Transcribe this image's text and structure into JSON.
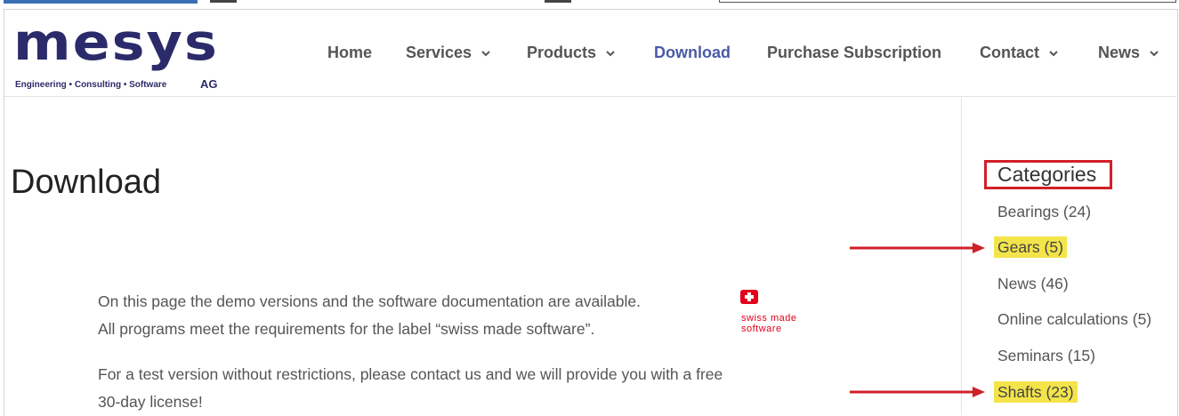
{
  "logo": {
    "word": "mesys",
    "tagline": "Engineering • Consulting • Software",
    "suffix": "AG"
  },
  "nav": {
    "items": [
      {
        "label": "Home",
        "dropdown": false
      },
      {
        "label": "Services",
        "dropdown": true
      },
      {
        "label": "Products",
        "dropdown": true
      },
      {
        "label": "Download",
        "dropdown": false,
        "active": true
      },
      {
        "label": "Purchase Subscription",
        "dropdown": false
      },
      {
        "label": "Contact",
        "dropdown": true
      },
      {
        "label": "News",
        "dropdown": true
      }
    ]
  },
  "main": {
    "title": "Download",
    "paragraph1_line1": "On this page the demo versions and the software documentation are available.",
    "paragraph1_line2": "All programs meet the requirements for the label “swiss made software”.",
    "paragraph2_line1": "For a test version without restrictions, please contact us and we will provide you with a free",
    "paragraph2_line2": "30-day license!",
    "badge_line1": "swiss made",
    "badge_line2": "software"
  },
  "sidebar": {
    "title": "Categories",
    "categories": [
      {
        "label": "Bearings (24)",
        "highlighted": false
      },
      {
        "label": "Gears (5)",
        "highlighted": true
      },
      {
        "label": "News (46)",
        "highlighted": false
      },
      {
        "label": "Online calculations (5)",
        "highlighted": false
      },
      {
        "label": "Seminars (15)",
        "highlighted": false
      },
      {
        "label": "Shafts (23)",
        "highlighted": true
      }
    ]
  },
  "colors": {
    "brand": "#2b2b6b",
    "nav_active": "#4a5aa8",
    "highlight": "#f3e44a",
    "annotation_red": "#d1202a",
    "swiss_red": "#e2001a"
  },
  "icons": [
    "chevron-down-icon",
    "swiss-flag-icon",
    "arrow-right-icon"
  ]
}
